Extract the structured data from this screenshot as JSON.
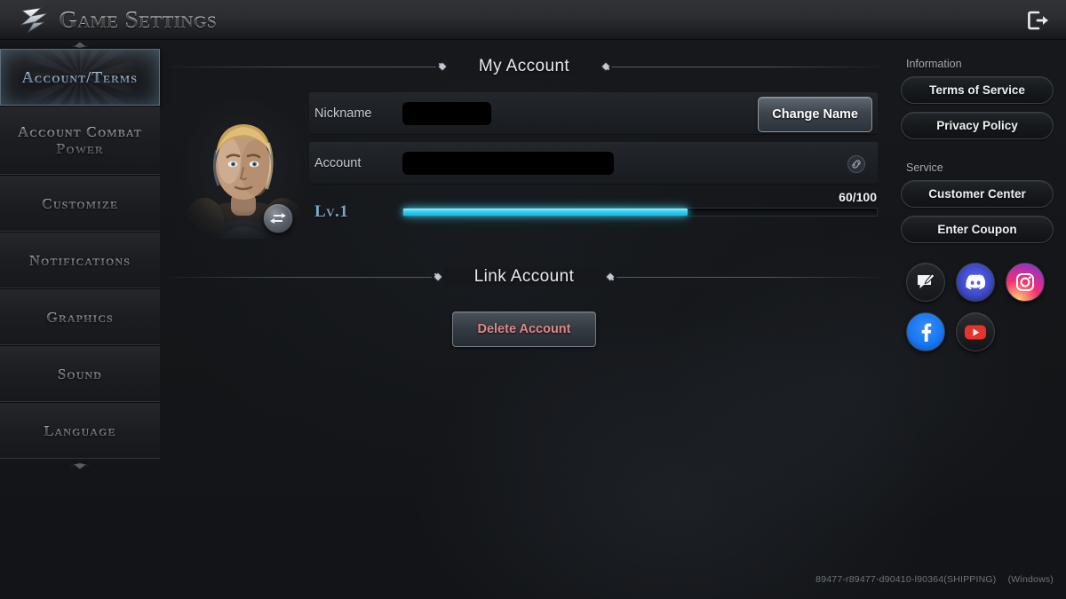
{
  "titlebar": {
    "title": "Game Settings",
    "logo_icon": "emblem-icon",
    "exit_icon": "exit-icon"
  },
  "sidebar": {
    "items": [
      {
        "label": "Account/Terms",
        "active": true
      },
      {
        "label": "Account Combat Power",
        "active": false
      },
      {
        "label": "Customize",
        "active": false
      },
      {
        "label": "Notifications",
        "active": false
      },
      {
        "label": "Graphics",
        "active": false
      },
      {
        "label": "Sound",
        "active": false
      },
      {
        "label": "Language",
        "active": false
      }
    ]
  },
  "main": {
    "my_account": {
      "section_title": "My Account",
      "nickname_label": "Nickname",
      "nickname_value": "",
      "change_name_label": "Change Name",
      "account_label": "Account",
      "account_value": "",
      "account_link_icon": "link-icon",
      "level_label": "Lv.1",
      "xp_text": "60/100",
      "xp_current": 60,
      "xp_max": 100,
      "swap_icon": "swap-arrows-icon"
    },
    "link_account": {
      "section_title": "Link Account",
      "delete_label": "Delete Account"
    }
  },
  "right_panel": {
    "information_heading": "Information",
    "information_buttons": [
      "Terms of Service",
      "Privacy Policy"
    ],
    "service_heading": "Service",
    "service_buttons": [
      "Customer Center",
      "Enter Coupon"
    ],
    "social": [
      {
        "name": "forum-icon"
      },
      {
        "name": "discord-icon"
      },
      {
        "name": "instagram-icon"
      },
      {
        "name": "facebook-icon"
      },
      {
        "name": "youtube-icon"
      }
    ]
  },
  "footer": {
    "build": "89477-r89477-d90410-l90364(SHIPPING)",
    "platform": "(Windows)"
  },
  "colors": {
    "accent_cyan": "#35d2f2",
    "active_blue": "#38789f",
    "danger_red": "#e08888",
    "background": "#16181c"
  }
}
